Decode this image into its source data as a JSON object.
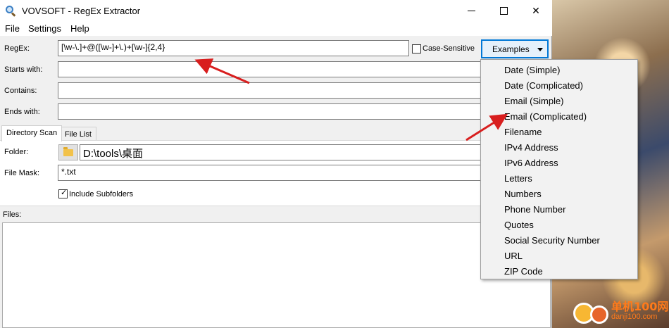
{
  "window": {
    "title": "VOVSOFT - RegEx Extractor"
  },
  "menu": {
    "file": "File",
    "settings": "Settings",
    "help": "Help"
  },
  "form": {
    "regex_label": "RegEx:",
    "regex_value": "[\\w-\\.]+@([\\w-]+\\.)+[\\w-]{2,4}",
    "case_sensitive_label": "Case-Sensitive",
    "case_sensitive_checked": false,
    "examples_button": "Examples",
    "starts_with_label": "Starts with:",
    "starts_with_value": "",
    "contains_label": "Contains:",
    "contains_value": "",
    "ends_with_label": "Ends with:",
    "ends_with_value": ""
  },
  "tabs": {
    "directory_scan": "Directory Scan",
    "file_list": "File List"
  },
  "scan": {
    "folder_label": "Folder:",
    "folder_value": "D:\\tools\\桌面",
    "file_mask_label": "File Mask:",
    "file_mask_value": "*.txt",
    "include_subfolders_label": "Include Subfolders",
    "include_subfolders_checked": true
  },
  "files": {
    "label": "Files:"
  },
  "examples_menu": {
    "items": [
      "Date (Simple)",
      "Date (Complicated)",
      "Email (Simple)",
      "Email (Complicated)",
      "Filename",
      "IPv4 Address",
      "IPv6 Address",
      "Letters",
      "Numbers",
      "Phone Number",
      "Quotes",
      "Social Security Number",
      "URL",
      "ZIP Code"
    ]
  },
  "watermark": {
    "text": "单机100网",
    "sub": "danji100.com"
  },
  "colors": {
    "accent": "#0078d7",
    "arrow": "#e02020",
    "window_bg": "#f0f0f0"
  }
}
